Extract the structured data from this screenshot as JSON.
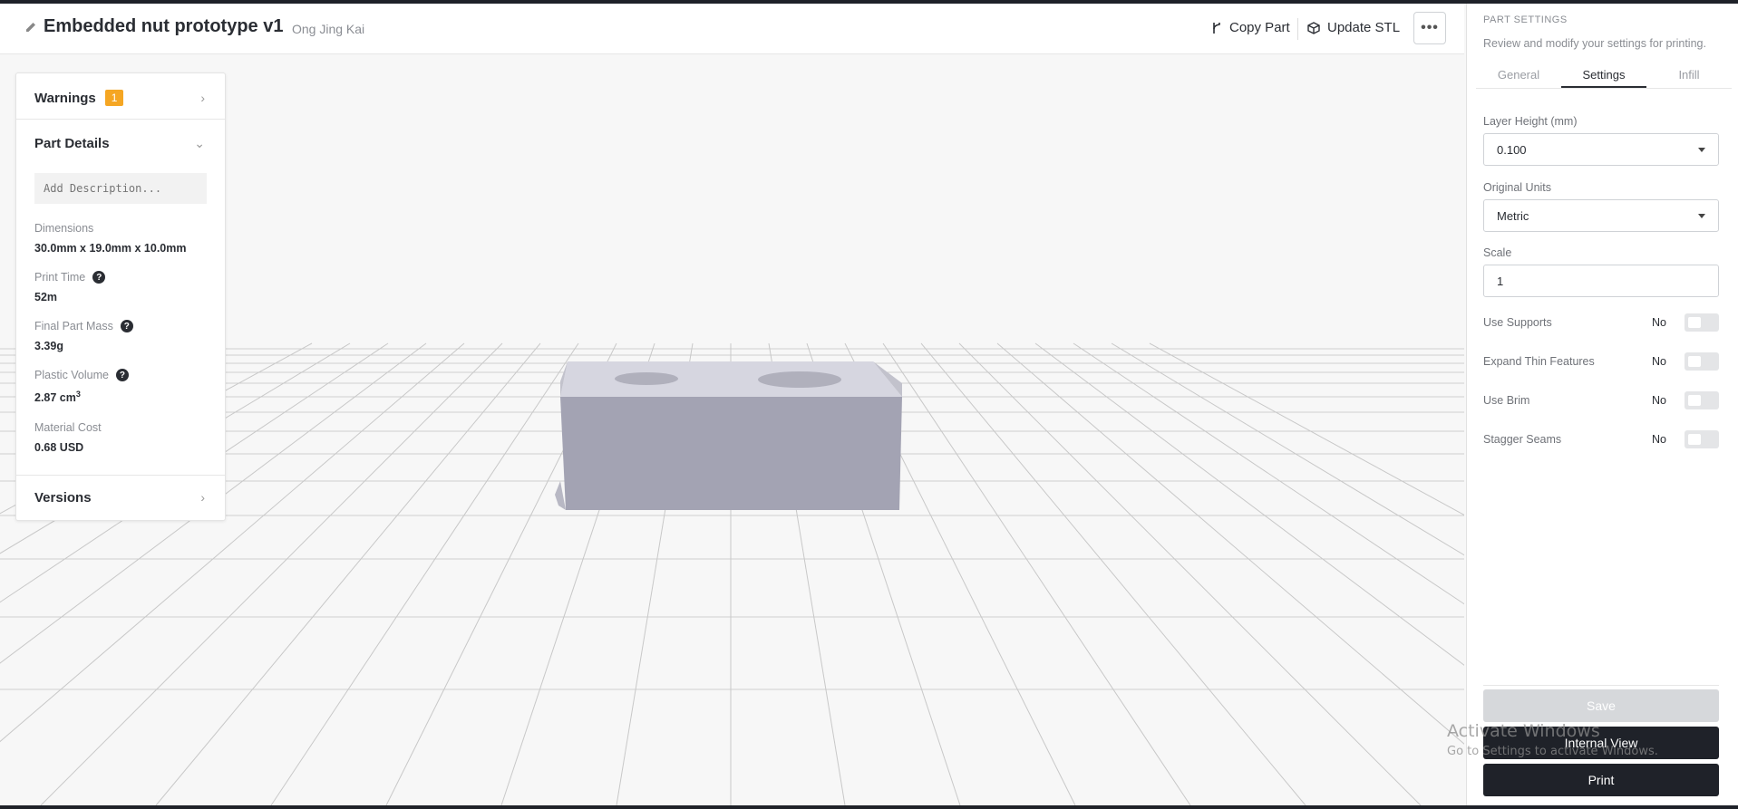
{
  "header": {
    "title": "Embedded nut prototype v1",
    "owner": "Ong Jing Kai",
    "copy_label": "Copy Part",
    "update_label": "Update STL",
    "more_label": "•••"
  },
  "left_panel": {
    "warnings_label": "Warnings",
    "warnings_count": "1",
    "part_details_label": "Part Details",
    "description_placeholder": "Add Description...",
    "dimensions_label": "Dimensions",
    "dimensions_value": "30.0mm x 19.0mm x 10.0mm",
    "print_time_label": "Print Time",
    "print_time_value": "52m",
    "mass_label": "Final Part Mass",
    "mass_value": "3.39g",
    "volume_label": "Plastic Volume",
    "volume_value": "2.87 cm",
    "volume_unit_sup": "3",
    "cost_label": "Material Cost",
    "cost_value": "0.68 USD",
    "versions_label": "Versions"
  },
  "right_panel": {
    "title": "PART SETTINGS",
    "subtitle": "Review and modify your settings for printing.",
    "tabs": [
      "General",
      "Settings",
      "Infill"
    ],
    "active_tab": "Settings",
    "layer_height_label": "Layer Height (mm)",
    "layer_height_value": "0.100",
    "units_label": "Original Units",
    "units_value": "Metric",
    "scale_label": "Scale",
    "scale_value": "1",
    "toggles": [
      {
        "label": "Use Supports",
        "value": "No"
      },
      {
        "label": "Expand Thin Features",
        "value": "No"
      },
      {
        "label": "Use Brim",
        "value": "No"
      },
      {
        "label": "Stagger Seams",
        "value": "No"
      }
    ],
    "save_label": "Save",
    "internal_view_label": "Internal View",
    "print_label": "Print"
  },
  "watermark": {
    "line1": "Activate Windows",
    "line2": "Go to Settings to activate Windows."
  },
  "colors": {
    "accent_dark": "#1f2229",
    "warning_badge": "#f5a623",
    "model": "#a3a3b3"
  },
  "icons": [
    "pencil-icon",
    "branch-icon",
    "cube-icon",
    "more-icon",
    "chevron-right-icon",
    "chevron-down-icon",
    "help-icon",
    "caret-down-icon"
  ]
}
